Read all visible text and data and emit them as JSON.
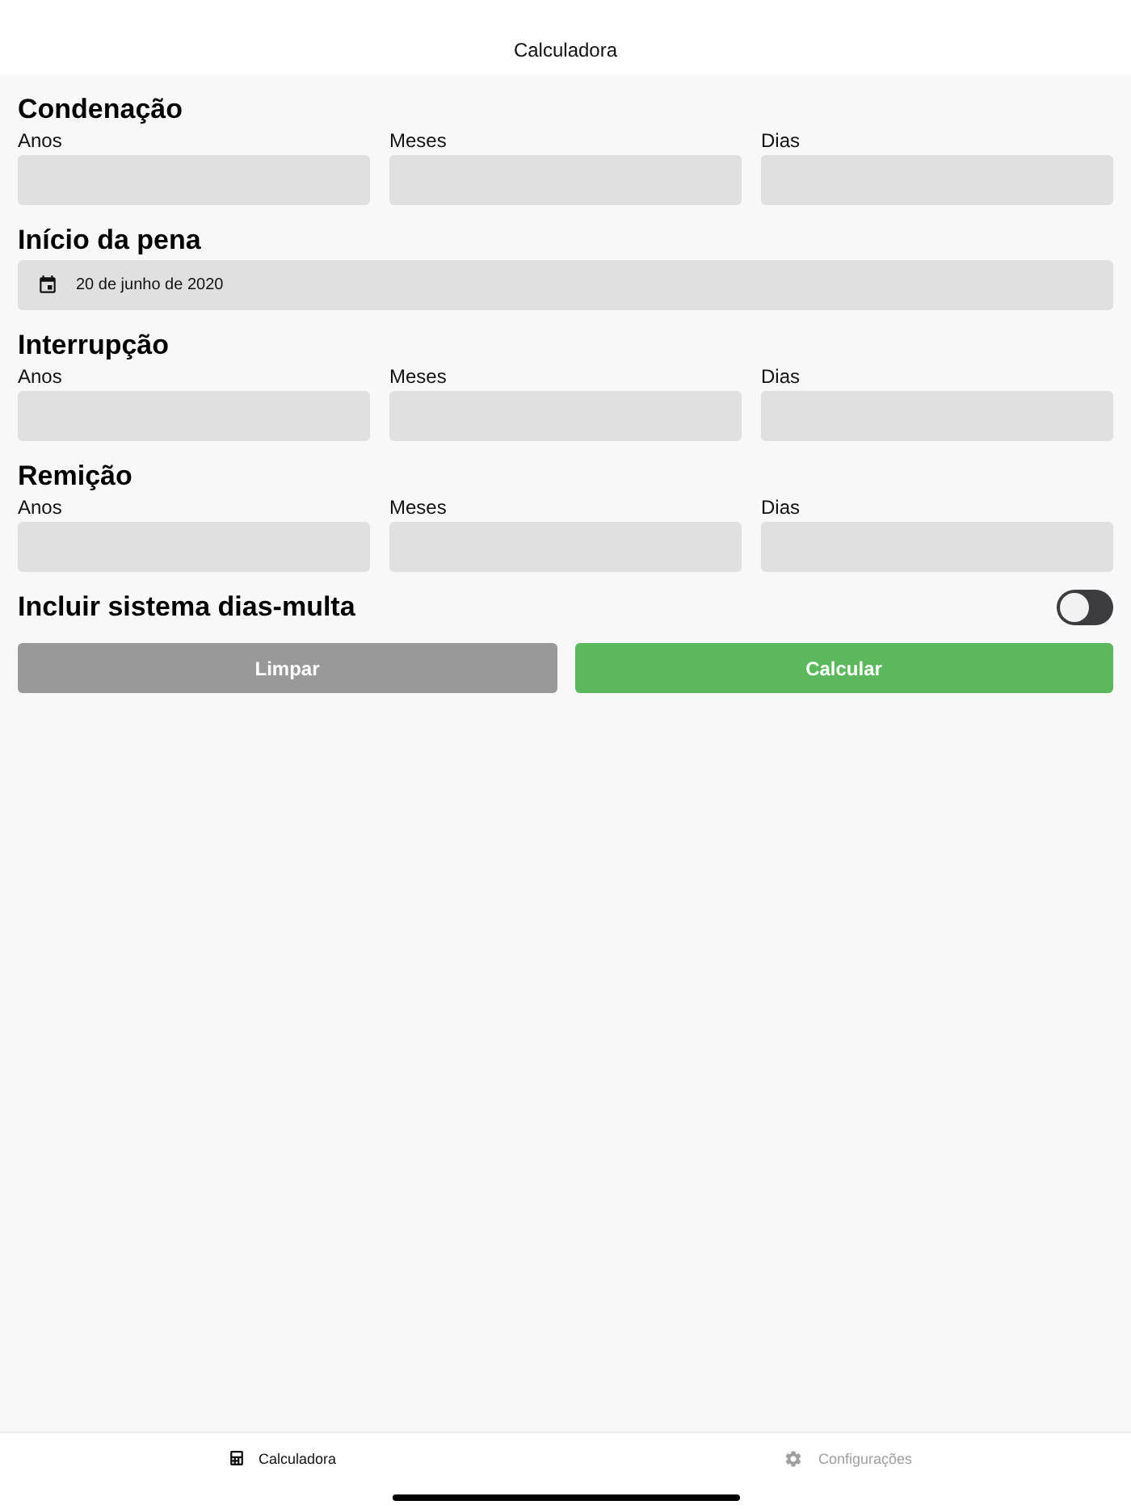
{
  "header": {
    "title": "Calculadora"
  },
  "sections": [
    {
      "kind": "duration",
      "title": "Condenação",
      "fields": [
        {
          "label": "Anos"
        },
        {
          "label": "Meses"
        },
        {
          "label": "Dias"
        }
      ]
    },
    {
      "kind": "date",
      "title": "Início da pena",
      "value": "20 de junho de 2020"
    },
    {
      "kind": "duration",
      "title": "Interrupção",
      "fields": [
        {
          "label": "Anos"
        },
        {
          "label": "Meses"
        },
        {
          "label": "Dias"
        }
      ]
    },
    {
      "kind": "duration",
      "title": "Remição",
      "fields": [
        {
          "label": "Anos"
        },
        {
          "label": "Meses"
        },
        {
          "label": "Dias"
        }
      ]
    }
  ],
  "toggle": {
    "label": "Incluir sistema dias-multa",
    "on": false
  },
  "buttons": [
    {
      "label": "Limpar",
      "kind": "secondary"
    },
    {
      "label": "Calcular",
      "kind": "primary"
    }
  ],
  "tab_bar": [
    {
      "label": "Calculadora",
      "selected": true
    },
    {
      "label": "Configurações",
      "selected": false
    }
  ]
}
